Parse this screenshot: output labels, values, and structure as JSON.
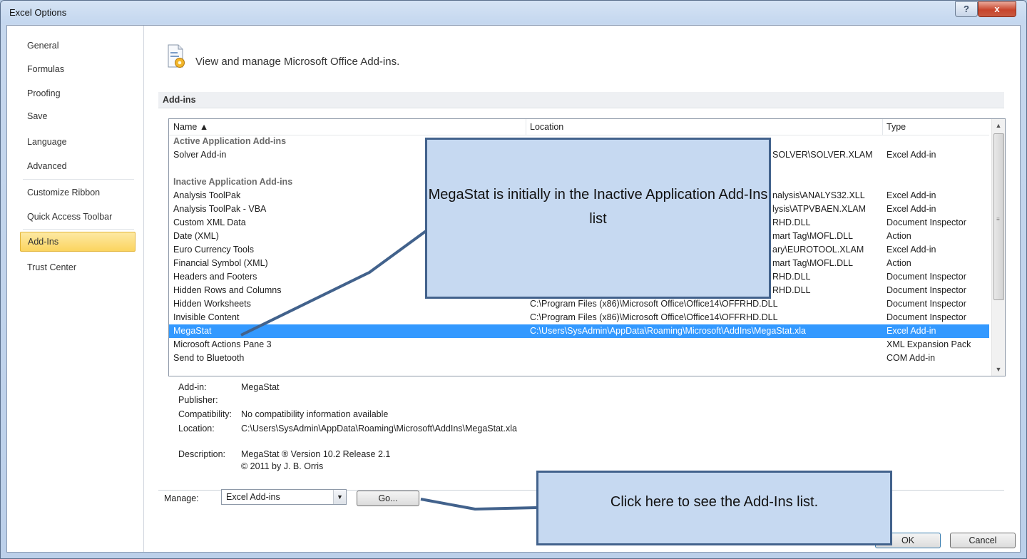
{
  "window": {
    "title": "Excel Options",
    "help_label": "?",
    "close_label": "x"
  },
  "nav": {
    "items": [
      {
        "label": "General"
      },
      {
        "label": "Formulas"
      },
      {
        "label": "Proofing"
      },
      {
        "label": "Save"
      },
      {
        "label": "Language"
      },
      {
        "label": "Advanced"
      },
      {
        "label": "Customize Ribbon"
      },
      {
        "label": "Quick Access Toolbar"
      },
      {
        "label": "Add-Ins"
      },
      {
        "label": "Trust Center"
      }
    ],
    "selected": "Add-Ins"
  },
  "header": {
    "text": "View and manage Microsoft Office Add-ins."
  },
  "section": {
    "title": "Add-ins"
  },
  "list": {
    "columns": [
      "Name ▲",
      "Location",
      "Type"
    ],
    "rows": [
      {
        "name": "Active Application Add-ins",
        "location": "",
        "type": ""
      },
      {
        "name": "Solver Add-in",
        "location": "SOLVER\\SOLVER.XLAM",
        "type": "Excel Add-in"
      },
      {
        "name": "",
        "location": "",
        "type": ""
      },
      {
        "name": "Inactive Application Add-ins",
        "location": "",
        "type": ""
      },
      {
        "name": "Analysis ToolPak",
        "location": "nalysis\\ANALYS32.XLL",
        "type": "Excel Add-in"
      },
      {
        "name": "Analysis ToolPak - VBA",
        "location": "lysis\\ATPVBAEN.XLAM",
        "type": "Excel Add-in"
      },
      {
        "name": "Custom XML Data",
        "location": "RHD.DLL",
        "type": "Document Inspector"
      },
      {
        "name": "Date (XML)",
        "location": "mart Tag\\MOFL.DLL",
        "type": "Action"
      },
      {
        "name": "Euro Currency Tools",
        "location": "ary\\EUROTOOL.XLAM",
        "type": "Excel Add-in"
      },
      {
        "name": "Financial Symbol (XML)",
        "location": "mart Tag\\MOFL.DLL",
        "type": "Action"
      },
      {
        "name": "Headers and Footers",
        "location": "RHD.DLL",
        "type": "Document Inspector"
      },
      {
        "name": "Hidden Rows and Columns",
        "location": "RHD.DLL",
        "type": "Document Inspector"
      },
      {
        "name": "Hidden Worksheets",
        "location": "C:\\Program Files (x86)\\Microsoft Office\\Office14\\OFFRHD.DLL",
        "type": "Document Inspector"
      },
      {
        "name": "Invisible Content",
        "location": "C:\\Program Files (x86)\\Microsoft Office\\Office14\\OFFRHD.DLL",
        "type": "Document Inspector"
      },
      {
        "name": "MegaStat",
        "location": "C:\\Users\\SysAdmin\\AppData\\Roaming\\Microsoft\\AddIns\\MegaStat.xla",
        "type": "Excel Add-in"
      },
      {
        "name": "Microsoft Actions Pane 3",
        "location": "",
        "type": "XML Expansion Pack"
      },
      {
        "name": "Send to Bluetooth",
        "location": "",
        "type": "COM Add-in"
      }
    ]
  },
  "details": {
    "addin_label": "Add-in:",
    "addin_value": "MegaStat",
    "publisher_label": "Publisher:",
    "publisher_value": "",
    "compat_label": "Compatibility:",
    "compat_value": "No compatibility information available",
    "location_label": "Location:",
    "location_value": "C:\\Users\\SysAdmin\\AppData\\Roaming\\Microsoft\\AddIns\\MegaStat.xla",
    "description_label": "Description:",
    "description_line1": "MegaStat ® Version 10.2 Release 2.1",
    "description_line2": "© 2011 by J. B. Orris"
  },
  "manage": {
    "label": "Manage:",
    "value": "Excel Add-ins",
    "go_label": "Go..."
  },
  "footer": {
    "ok_label": "OK",
    "cancel_label": "Cancel"
  },
  "callouts": {
    "first": "MegaStat is initially in the Inactive Application Add-Ins list",
    "second": "Click here to see the Add-Ins list."
  },
  "colors": {
    "selection": "#3399ff",
    "callout_fill": "#c6d9f1",
    "callout_border": "#42628c",
    "nav_selected": "#fbd45f"
  },
  "icons": [
    "addins-gear-icon",
    "sort-up-icon",
    "scroll-up-icon",
    "scroll-down-icon",
    "dropdown-arrow-icon",
    "help-icon",
    "close-icon"
  ]
}
